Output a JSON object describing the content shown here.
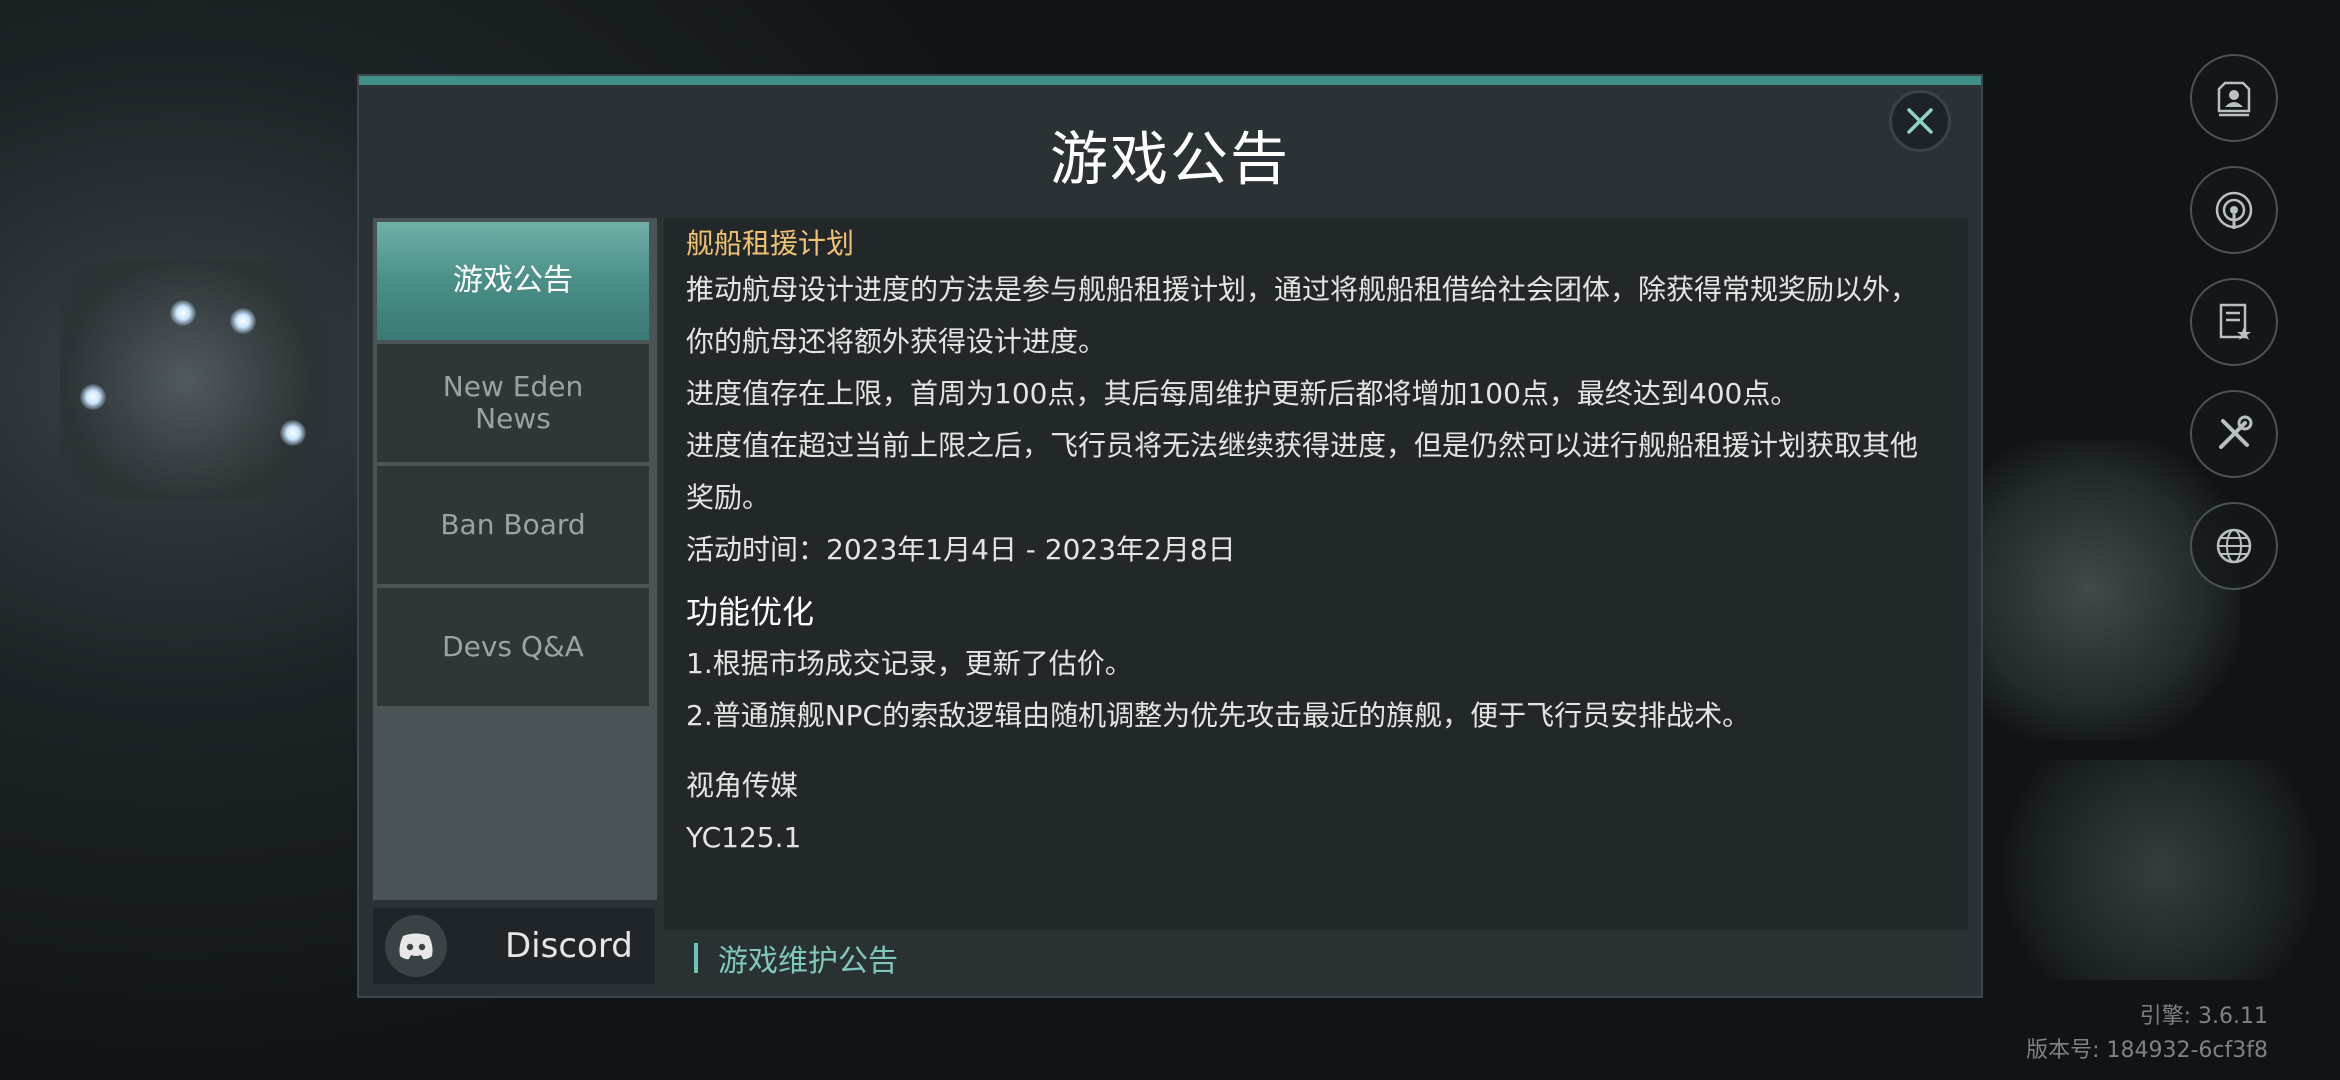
{
  "dialog": {
    "title": "游戏公告",
    "close_icon": "close-icon"
  },
  "nav": {
    "items": [
      {
        "label": "游戏公告",
        "active": true
      },
      {
        "label": "New Eden\nNews",
        "active": false
      },
      {
        "label": "Ban Board",
        "active": false
      },
      {
        "label": "Devs Q&A",
        "active": false
      }
    ],
    "discord": {
      "label": "Discord",
      "icon": "discord-icon"
    }
  },
  "content": {
    "heading": "舰船租援计划",
    "para1": "推动航母设计进度的方法是参与舰船租援计划，通过将舰船租借给社会团体，除获得常规奖励以外，你的航母还将额外获得设计进度。",
    "para2": "进度值存在上限，首周为100点，其后每周维护更新后都将增加100点，最终达到400点。",
    "para3": "进度值在超过当前上限之后，飞行员将无法继续获得进度，但是仍然可以进行舰船租援计划获取其他奖励。",
    "activity_time": "活动时间：2023年1月4日 - 2023年2月8日",
    "section_title": "功能优化",
    "item1": "1.根据市场成交记录，更新了估价。",
    "item2": "2.普通旗舰NPC的索敌逻辑由随机调整为优先攻击最近的旗舰，便于飞行员安排战术。",
    "signature": "视角传媒",
    "version_code": "YC125.1",
    "next_tab": "游戏维护公告"
  },
  "side_buttons": [
    "profile-icon",
    "signal-icon",
    "notes-icon",
    "tools-icon",
    "globe-icon"
  ],
  "version": {
    "engine": "引擎: 3.6.11",
    "build": "版本号: 184932-6cf3f8"
  },
  "colors": {
    "accent": "#3f8f86",
    "active_tab": "#5a9f96",
    "heading": "#f0c170"
  }
}
